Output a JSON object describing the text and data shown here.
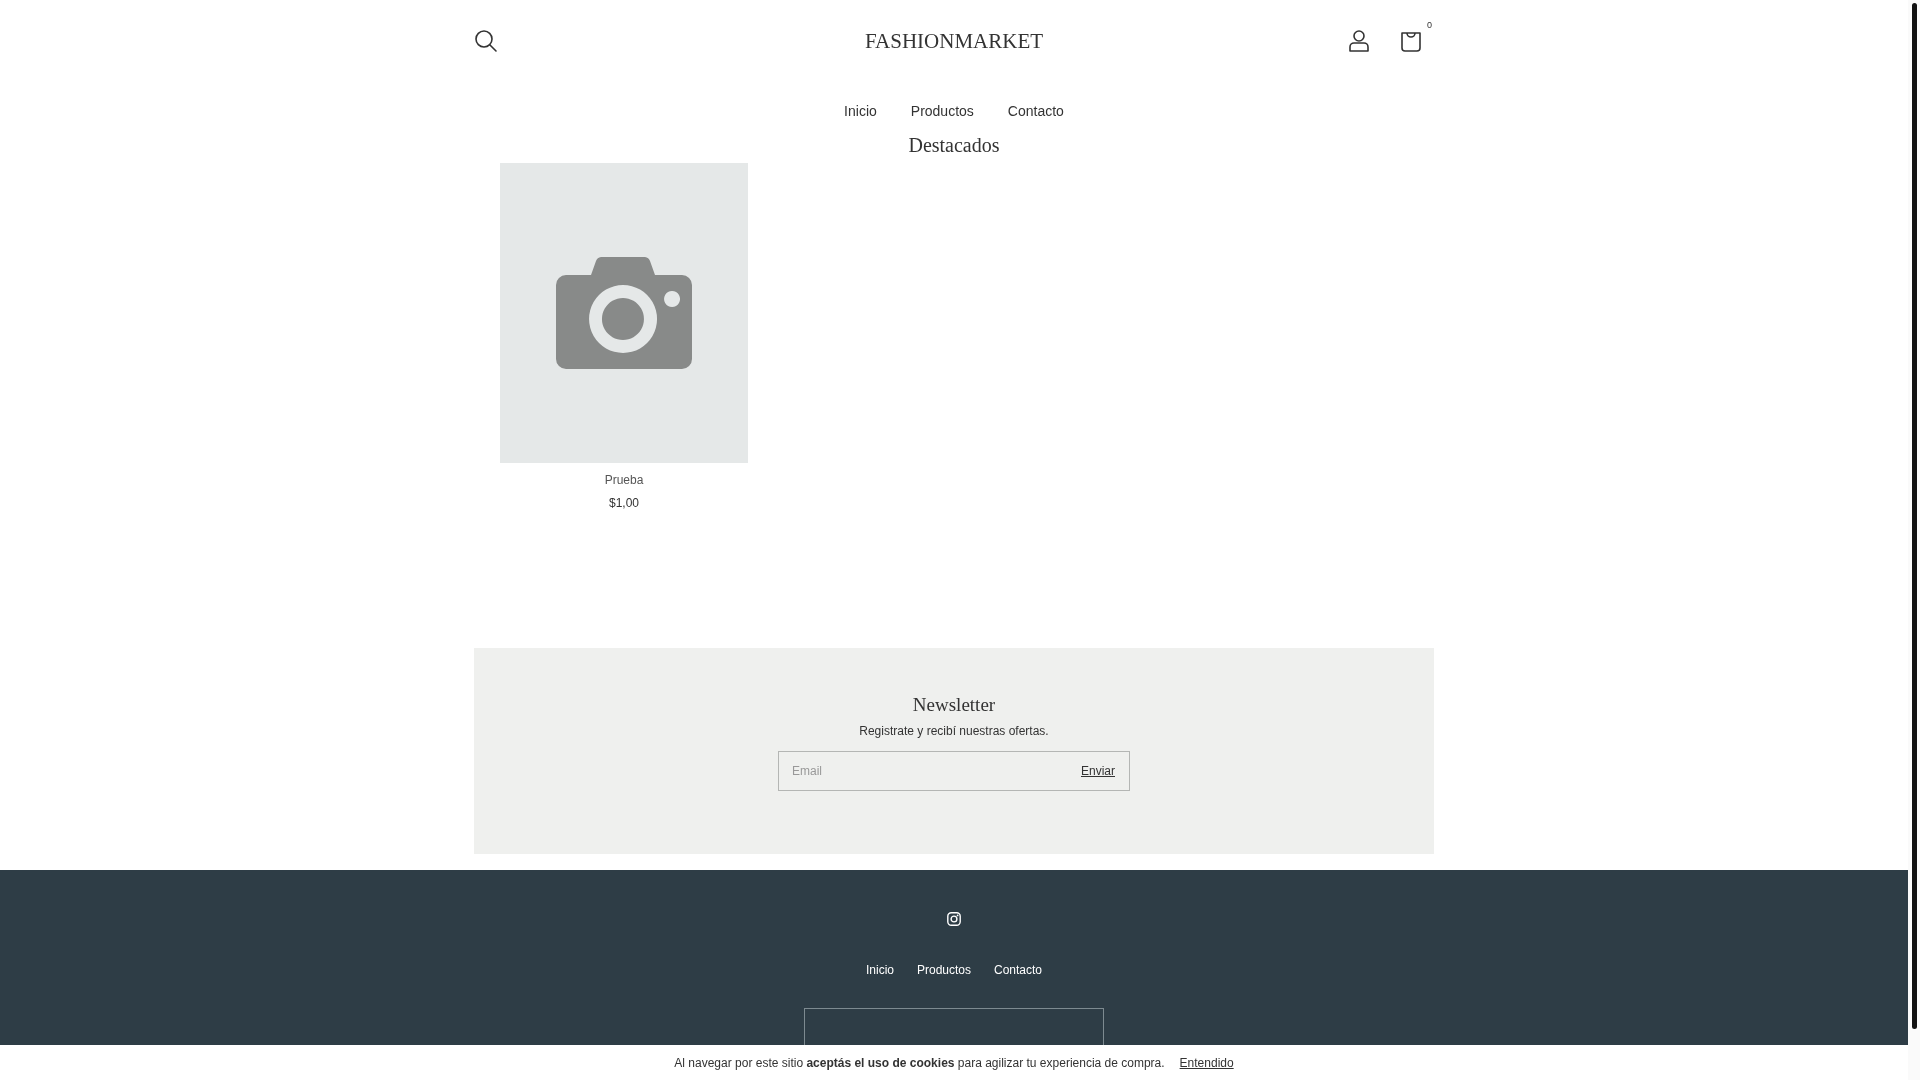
{
  "header": {
    "logo": "FASHIONMARKET",
    "cart_count": "0"
  },
  "nav": [
    {
      "label": "Inicio"
    },
    {
      "label": "Productos"
    },
    {
      "label": "Contacto"
    }
  ],
  "featured": {
    "title": "Destacados",
    "products": [
      {
        "name": "Prueba",
        "price": "$1,00"
      }
    ]
  },
  "newsletter": {
    "title": "Newsletter",
    "text": "Registrate y recibí nuestras ofertas.",
    "email": {
      "placeholder": "Email"
    },
    "button": "Enviar"
  },
  "footer": {
    "links": [
      {
        "label": "Inicio"
      },
      {
        "label": "Productos"
      },
      {
        "label": "Contacto"
      }
    ]
  },
  "cookie_bar": {
    "text": "Al navegar por este sitio **aceptás el uso de cookies** para agilizar tu experiencia de compra.",
    "button": "Entendido"
  }
}
